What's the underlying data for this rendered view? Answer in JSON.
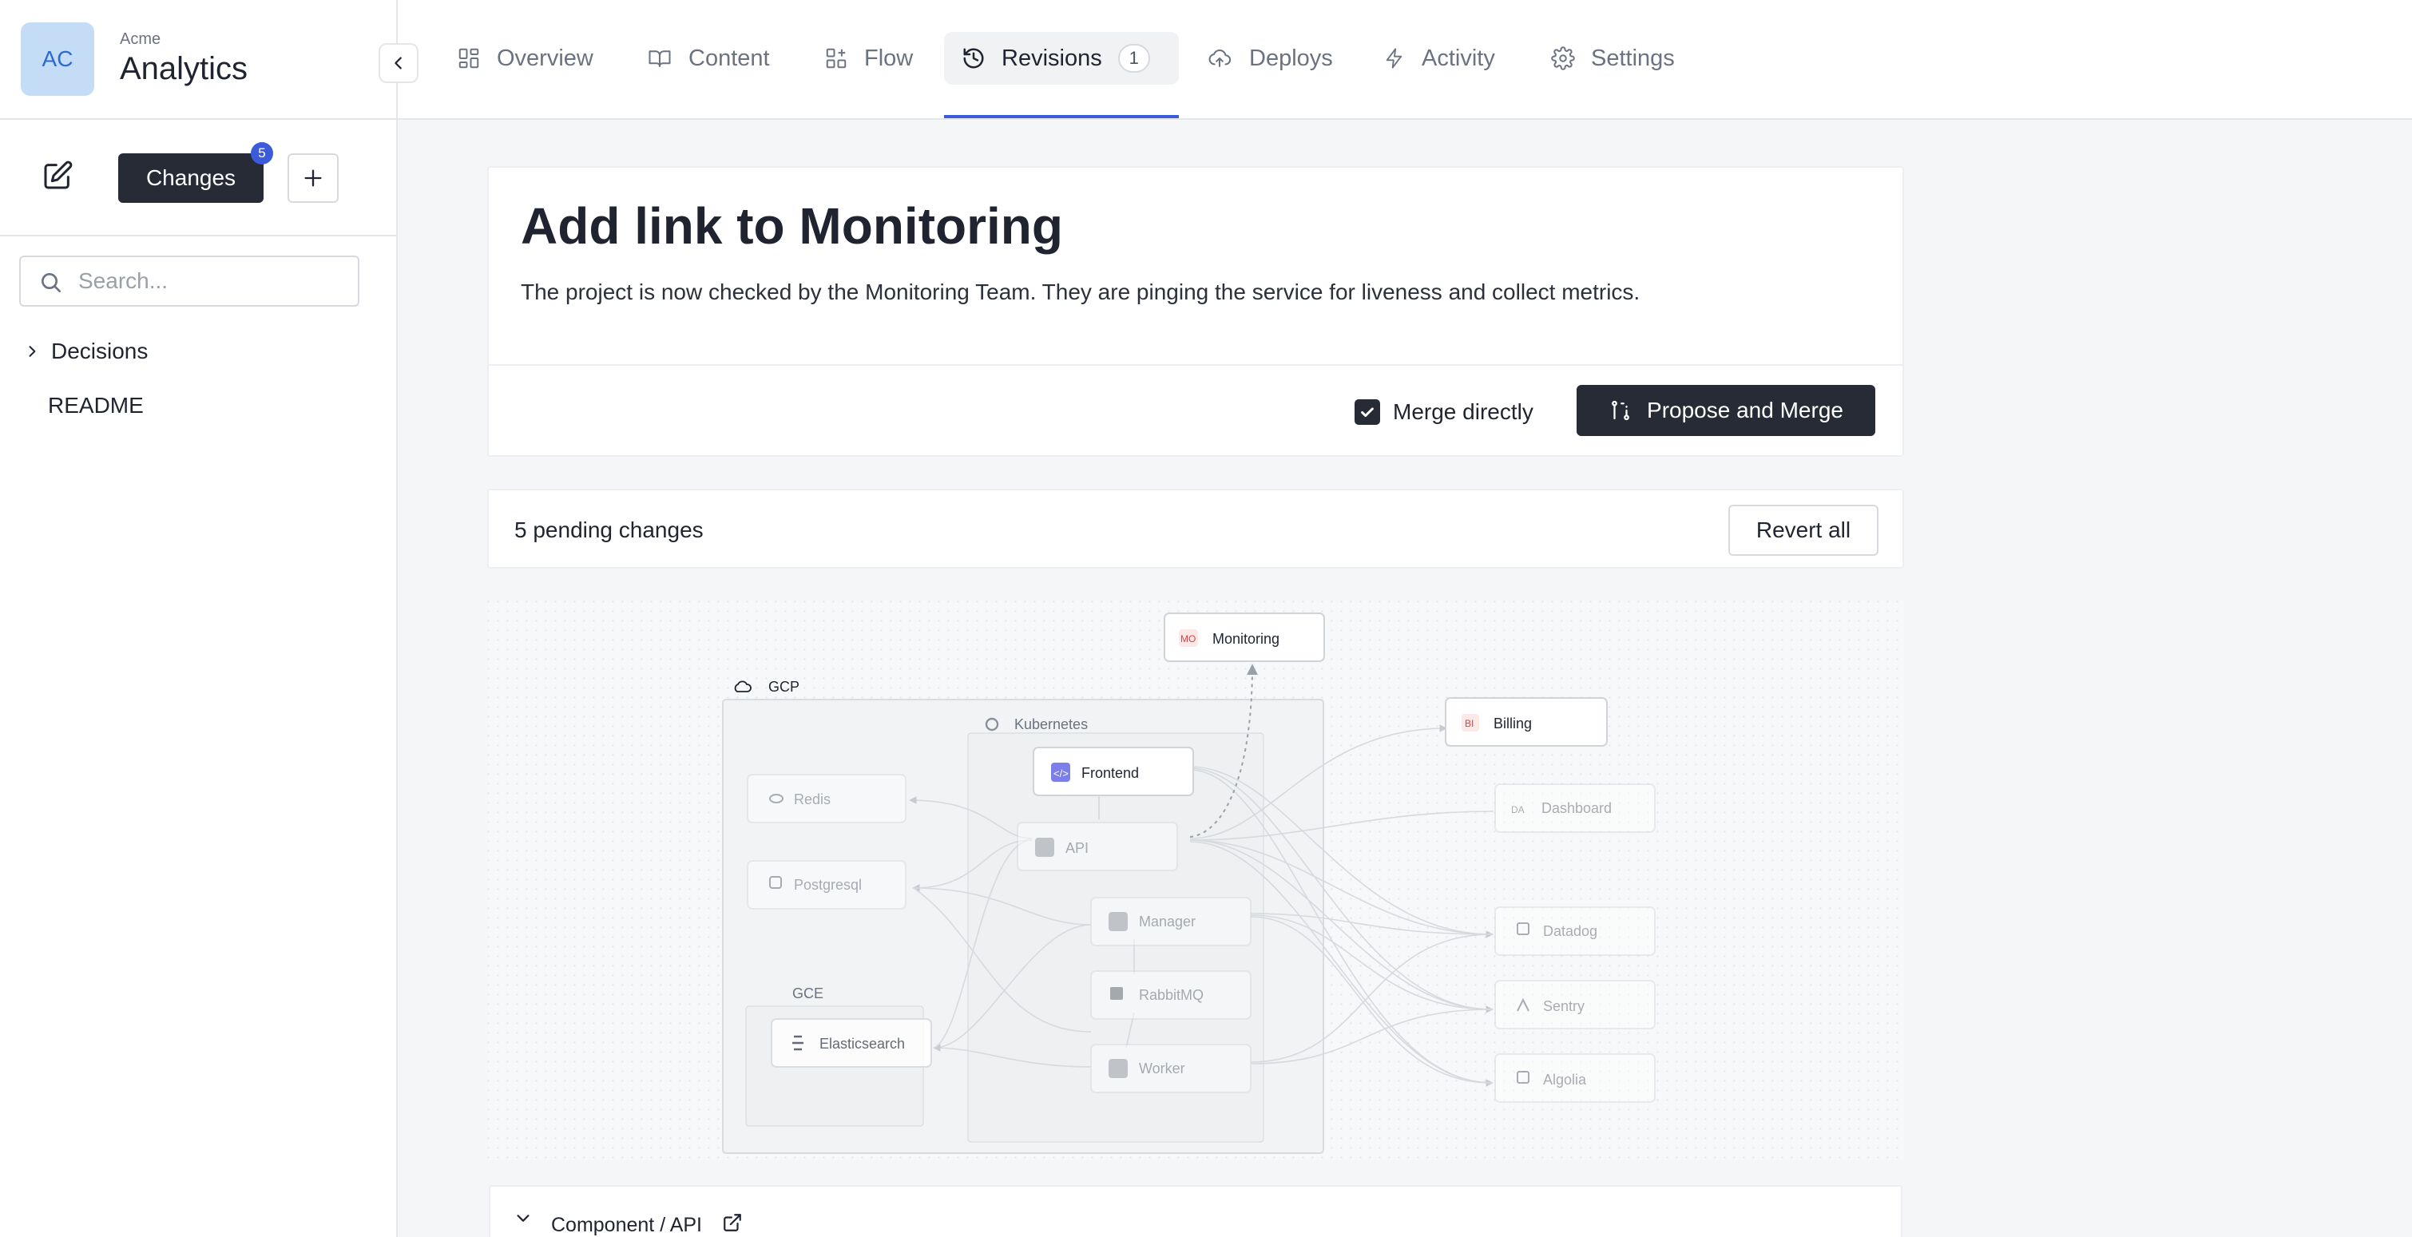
{
  "app": {
    "org": "Acme",
    "name": "Analytics",
    "avatar_initials": "AC",
    "accent": "#3b5bdb"
  },
  "sidebar": {
    "changes_label": "Changes",
    "changes_count": "5",
    "search_placeholder": "Search...",
    "items": [
      {
        "label": "Decisions",
        "expandable": true
      },
      {
        "label": "README",
        "expandable": false
      }
    ]
  },
  "tabs": [
    {
      "label": "Overview",
      "icon": "grid-icon",
      "active": false
    },
    {
      "label": "Content",
      "icon": "book-icon",
      "active": false
    },
    {
      "label": "Flow",
      "icon": "flow-icon",
      "active": false
    },
    {
      "label": "Revisions",
      "icon": "history-icon",
      "active": true,
      "count": "1"
    },
    {
      "label": "Deploys",
      "icon": "cloud-upload-icon",
      "active": false
    },
    {
      "label": "Activity",
      "icon": "bolt-icon",
      "active": false
    },
    {
      "label": "Settings",
      "icon": "gear-icon",
      "active": false
    }
  ],
  "revision": {
    "title": "Add link to Monitoring",
    "description": "The project is now checked by the Monitoring Team. They are pinging the service for liveness and collect metrics.",
    "merge_directly_label": "Merge directly",
    "merge_directly_checked": true,
    "propose_label": "Propose and Merge"
  },
  "pending": {
    "text": "5 pending changes",
    "revert_label": "Revert all"
  },
  "diagram": {
    "groups": {
      "gcp": "GCP",
      "kubernetes": "Kubernetes",
      "gce": "GCE"
    },
    "nodes": {
      "monitoring": {
        "label": "Monitoring",
        "badge": "MO"
      },
      "billing": {
        "label": "Billing",
        "badge": "BI"
      },
      "frontend": {
        "label": "Frontend"
      },
      "redis": {
        "label": "Redis"
      },
      "api": {
        "label": "API"
      },
      "postgresql": {
        "label": "Postgresql"
      },
      "manager": {
        "label": "Manager"
      },
      "rabbitmq": {
        "label": "RabbitMQ"
      },
      "elasticsearch": {
        "label": "Elasticsearch"
      },
      "worker": {
        "label": "Worker"
      },
      "dashboard": {
        "label": "Dashboard",
        "badge": "DA"
      },
      "datadog": {
        "label": "Datadog"
      },
      "sentry": {
        "label": "Sentry"
      },
      "algolia": {
        "label": "Algolia"
      }
    }
  },
  "component_row": {
    "label": "Component / API"
  }
}
